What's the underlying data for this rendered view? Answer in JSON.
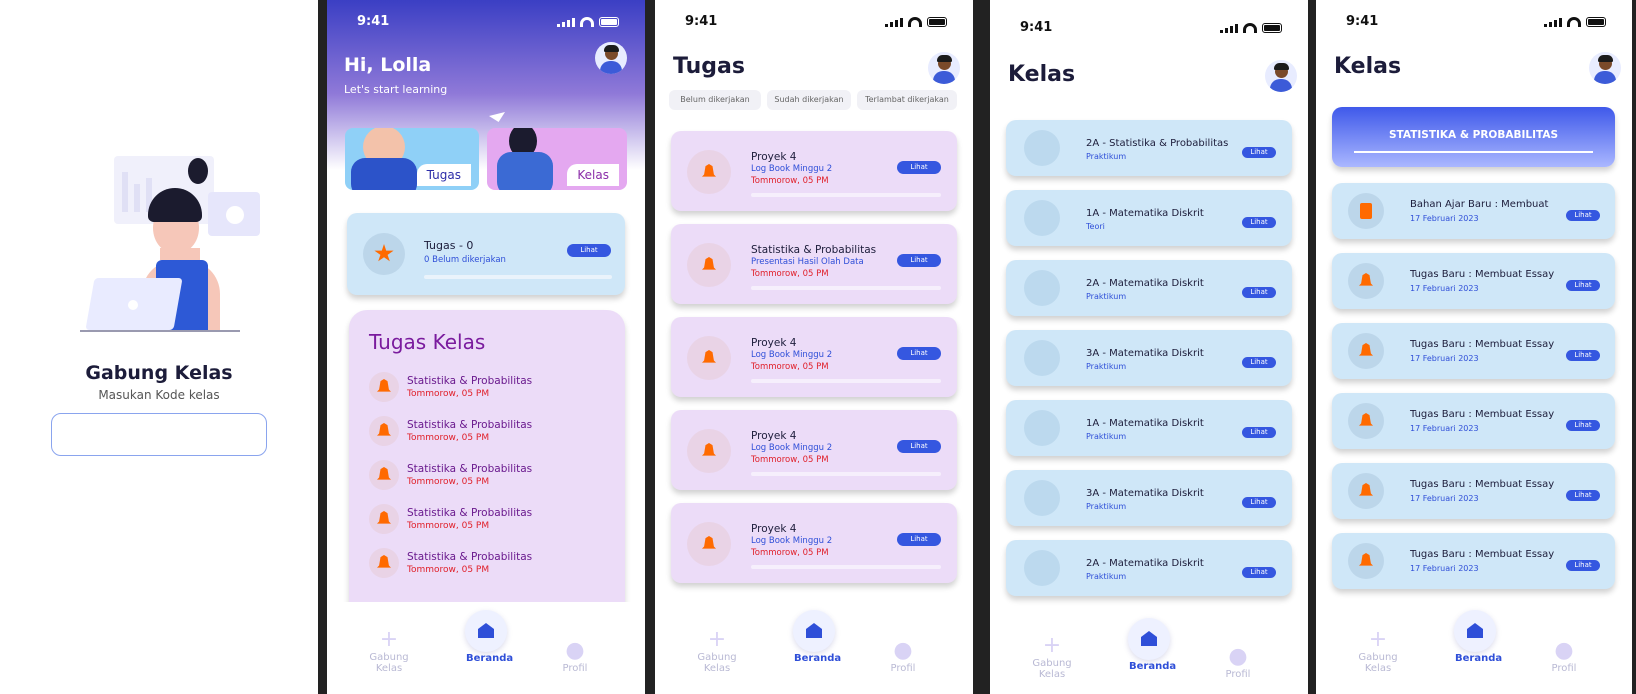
{
  "status_time": "9:41",
  "s1": {
    "title": "Gabung Kelas",
    "subtitle": "Masukan Kode kelas",
    "input_value": ""
  },
  "s2": {
    "greet": "Hi, Lolla",
    "sub": "Let's start learning",
    "tile_tugas": "Tugas",
    "tile_kelas": "Kelas",
    "summary": {
      "title": "Tugas - 0",
      "sub": "0 Belum dikerjakan",
      "btn": "Lihat"
    },
    "tk_title": "Tugas Kelas",
    "items": [
      {
        "t": "Statistika & Probabilitas",
        "d": "Tommorow, 05 PM"
      },
      {
        "t": "Statistika & Probabilitas",
        "d": "Tommorow, 05 PM"
      },
      {
        "t": "Statistika & Probabilitas",
        "d": "Tommorow, 05 PM"
      },
      {
        "t": "Statistika & Probabilitas",
        "d": "Tommorow, 05 PM"
      },
      {
        "t": "Statistika & Probabilitas",
        "d": "Tommorow, 05 PM"
      }
    ]
  },
  "s3": {
    "title": "Tugas",
    "filters": [
      "Belum dikerjakan",
      "Sudah dikerjakan",
      "Terlambat dikerjakan"
    ],
    "cards": [
      {
        "t": "Proyek 4",
        "s": "Log Book Minggu 2",
        "d": "Tommorow, 05 PM"
      },
      {
        "t": "Statistika & Probabilitas",
        "s": "Presentasi Hasil Olah Data",
        "d": "Tommorow, 05 PM"
      },
      {
        "t": "Proyek 4",
        "s": "Log Book Minggu 2",
        "d": "Tommorow, 05 PM"
      },
      {
        "t": "Proyek 4",
        "s": "Log Book Minggu 2",
        "d": "Tommorow, 05 PM"
      },
      {
        "t": "Proyek 4",
        "s": "Log Book Minggu 2",
        "d": "Tommorow, 05 PM"
      }
    ]
  },
  "s4": {
    "title": "Kelas",
    "cards": [
      {
        "t": "2A - Statistika & Probabilitas",
        "s": "Praktikum"
      },
      {
        "t": "1A - Matematika Diskrit",
        "s": "Teori"
      },
      {
        "t": "2A - Matematika Diskrit",
        "s": "Praktikum"
      },
      {
        "t": "3A - Matematika Diskrit",
        "s": "Praktikum"
      },
      {
        "t": "1A - Matematika Diskrit",
        "s": "Praktikum"
      },
      {
        "t": "3A - Matematika Diskrit",
        "s": "Praktikum"
      },
      {
        "t": "2A - Matematika Diskrit",
        "s": "Praktikum"
      }
    ]
  },
  "s5": {
    "title": "Kelas",
    "banner": "STATISTIKA & PROBABILITAS",
    "cards": [
      {
        "t": "Bahan Ajar Baru : Membuat",
        "d": "17 Februari 2023"
      },
      {
        "t": "Tugas Baru : Membuat Essay",
        "d": "17 Februari 2023"
      },
      {
        "t": "Tugas Baru : Membuat Essay",
        "d": "17 Februari 2023"
      },
      {
        "t": "Tugas Baru : Membuat Essay",
        "d": "17 Februari 2023"
      },
      {
        "t": "Tugas Baru : Membuat Essay",
        "d": "17 Februari 2023"
      },
      {
        "t": "Tugas Baru : Membuat Essay",
        "d": "17 Februari 2023"
      }
    ]
  },
  "btn": "Lihat",
  "nav": {
    "gabung": "Gabung Kelas",
    "beranda": "Beranda",
    "profil": "Profil"
  },
  "colors": {
    "primary": "#3557e0",
    "purple_card": "#ecdcf8",
    "blue_card": "#cfe7f8",
    "accent": "#ff6a00"
  }
}
